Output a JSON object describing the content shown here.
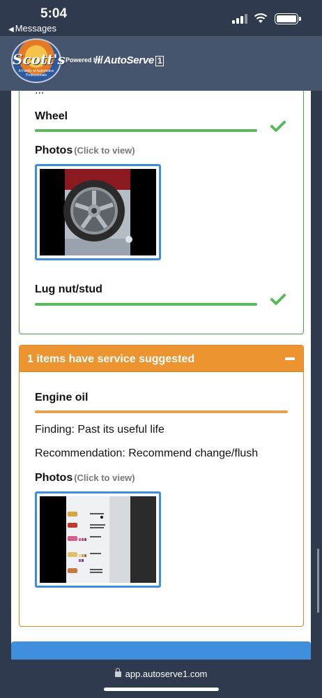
{
  "status_bar": {
    "time": "5:04",
    "back_label": "Messages"
  },
  "header": {
    "logo_text": "Scott's",
    "logo_subtext": "A Family of Automotive Professionals",
    "powered_by": "Powered by",
    "brand_name": "AutoServe",
    "brand_number": "1"
  },
  "passed_section": {
    "cut_off_text": "...",
    "items": [
      {
        "title": "Wheel",
        "status_color": "#5cb85c"
      },
      {
        "title": "Lug nut/stud",
        "status_color": "#5cb85c"
      }
    ],
    "photos_label": "Photos",
    "photos_hint": "(Click to view)"
  },
  "suggested_section": {
    "header": "1 items have service suggested",
    "header_color": "#ec9430",
    "item_title": "Engine oil",
    "finding": "Finding: Past its useful life",
    "recommendation": "Recommendation: Recommend change/flush",
    "photos_label": "Photos",
    "photos_hint": "(Click to view)",
    "fluid_chart_labels": [
      "Engine Oil",
      "Automatic Transmission Fluid",
      "Coolant",
      "Brake Fluid",
      "Power Steering Fluid"
    ]
  },
  "safari": {
    "url": "app.autoserve1.com"
  },
  "colors": {
    "pass_green": "#5cb85c",
    "suggest_orange": "#ec9430",
    "accent_blue": "#3f8fdd"
  }
}
